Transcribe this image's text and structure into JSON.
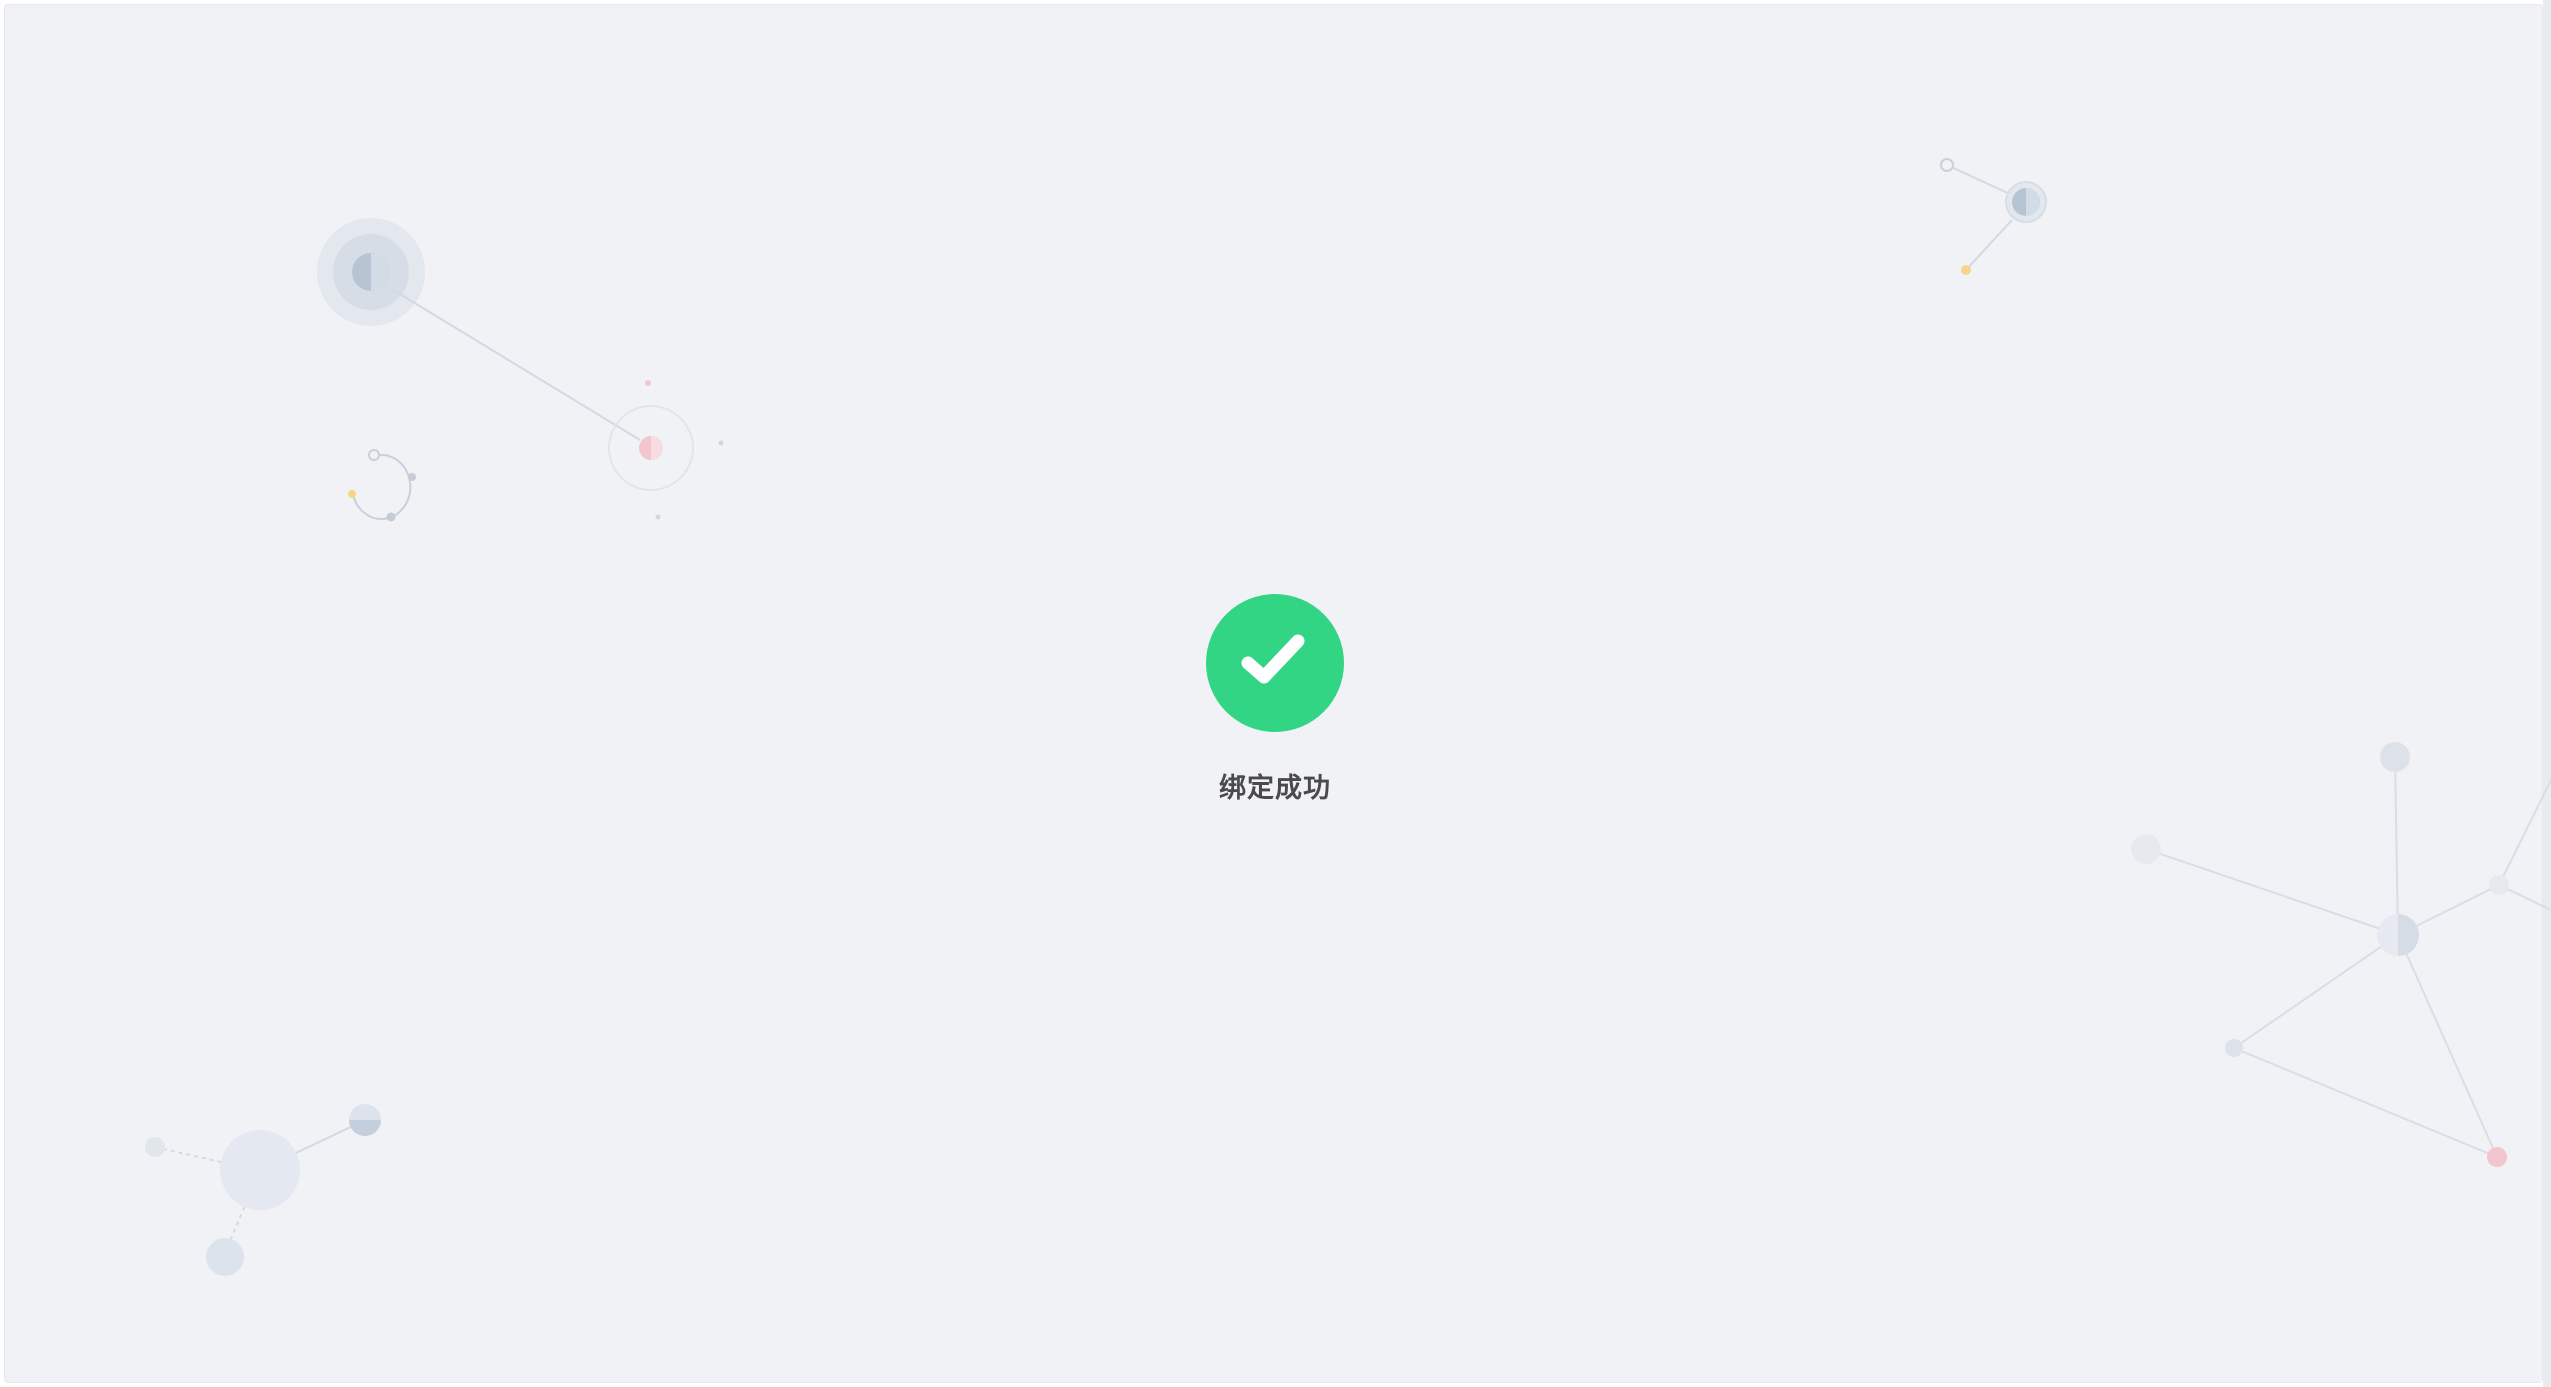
{
  "result": {
    "status": "success",
    "icon": "check-circle-icon",
    "message": "绑定成功"
  },
  "colors": {
    "background": "#f0f2f5",
    "success": "#32d583",
    "text": "#4a4a4a",
    "decor_line": "#d9dde5",
    "decor_node": "#d3dae6",
    "decor_accent_pink": "#f2c6cc",
    "decor_accent_yellow": "#f6d58a"
  }
}
